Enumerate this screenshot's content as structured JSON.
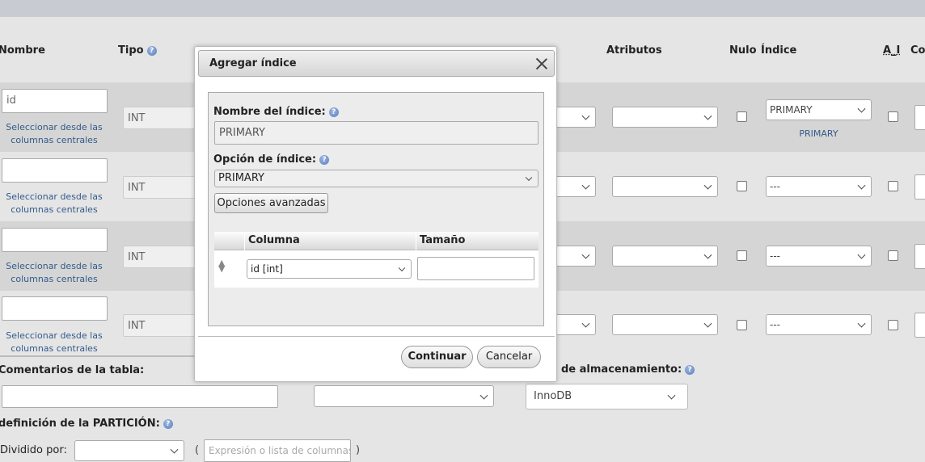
{
  "columns": {
    "nombre": "Nombre",
    "tipo": "Tipo",
    "atributos": "Atributos",
    "nulo": "Nulo",
    "indice": "Índice",
    "ai": "A_I",
    "comentarios_partial": "Co"
  },
  "rows": [
    {
      "name_value": "id",
      "name_placeholder": "",
      "link": "Seleccionar desde las columnas centrales",
      "type": "INT",
      "index": "PRIMARY",
      "index_note": "PRIMARY"
    },
    {
      "name_value": "",
      "link": "Seleccionar desde las columnas centrales",
      "type": "INT",
      "index": "---",
      "index_note": ""
    },
    {
      "name_value": "",
      "link": "Seleccionar desde las columnas centrales",
      "type": "INT",
      "index": "---",
      "index_note": ""
    },
    {
      "name_value": "",
      "link": "Seleccionar desde las columnas centrales",
      "type": "INT",
      "index": "---",
      "index_note": ""
    }
  ],
  "footer": {
    "table_comments_label": "Comentarios de la tabla:",
    "storage_label": "de almacenamiento:",
    "storage_value": "InnoDB",
    "partition_label": "definición de la PARTICIÓN:",
    "divided_by_label": "Dividido por:",
    "paren_open": "(",
    "paren_close": ")",
    "expression_placeholder": "Expresión o lista de columnas"
  },
  "modal": {
    "title": "Agregar índice",
    "index_name_label": "Nombre del índice:",
    "index_name_value": "PRIMARY",
    "index_option_label": "Opción de índice:",
    "index_option_value": "PRIMARY",
    "advanced_button": "Opciones avanzadas",
    "table": {
      "col_header": "Columna",
      "size_header": "Tamaño",
      "column_value": "id [int]",
      "size_value": ""
    },
    "continue_button": "Continuar",
    "cancel_button": "Cancelar"
  },
  "icons": {
    "help": "help-icon",
    "close": "close-icon",
    "chevron": "chevron-down-icon",
    "drag": "drag-handle-icon"
  },
  "colors": {
    "background": "#e5e5e5",
    "row_dark": "#d5d5d5",
    "link": "#335a8a",
    "topbar": "#c8cbd1"
  }
}
